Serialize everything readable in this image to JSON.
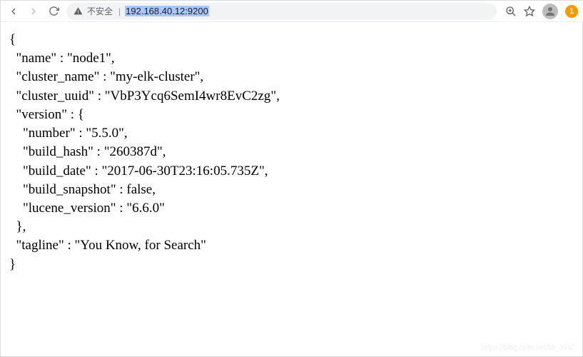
{
  "toolbar": {
    "security_label": "不安全",
    "separator": "|",
    "url": "192.168.40.12:9200",
    "notification_count": "1"
  },
  "response": {
    "name": "node1",
    "cluster_name": "my-elk-cluster",
    "cluster_uuid": "VbP3Ycq6SemI4wr8EvC2zg",
    "version": {
      "number": "5.5.0",
      "build_hash": "260387d",
      "build_date": "2017-06-30T23:16:05.735Z",
      "build_snapshot": "false",
      "lucene_version": "6.6.0"
    },
    "tagline": "You Know, for Search"
  },
  "key_labels": {
    "name": "name",
    "cluster_name": "cluster_name",
    "cluster_uuid": "cluster_uuid",
    "version": "version",
    "number": "number",
    "build_hash": "build_hash",
    "build_date": "build_date",
    "build_snapshot": "build_snapshot",
    "lucene_version": "lucene_version",
    "tagline": "tagline"
  },
  "watermark": "https://blog.csdn.net/Mr_XHC"
}
